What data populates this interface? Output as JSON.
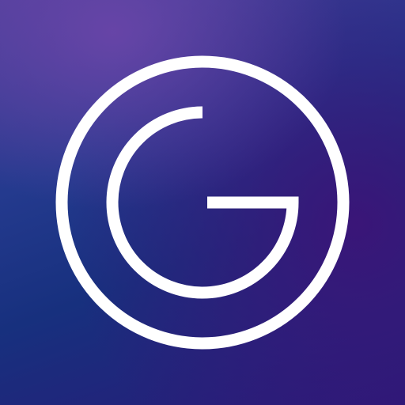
{
  "app_icon": {
    "name": "G logo app icon",
    "colors": {
      "background_top_left": "#4b3f9a",
      "background_center": "#17307e",
      "background_bottom_right": "#2a1a78",
      "glyph": "#ffffff"
    },
    "glyph_icon": "letter-g-in-circle-icon"
  }
}
